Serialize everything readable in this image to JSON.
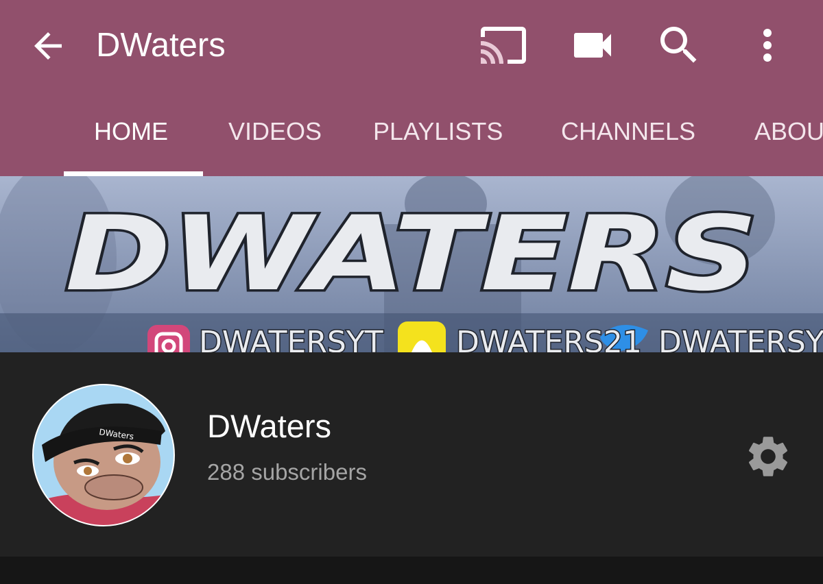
{
  "header": {
    "title": "DWaters",
    "back_icon": "arrow-back-icon",
    "actions": [
      "cast-icon",
      "video-camera-icon",
      "search-icon",
      "more-vert-icon"
    ],
    "background_color": "#91506C"
  },
  "tabs": [
    {
      "label": "HOME",
      "selected": true
    },
    {
      "label": "VIDEOS",
      "selected": false
    },
    {
      "label": "PLAYLISTS",
      "selected": false
    },
    {
      "label": "CHANNELS",
      "selected": false
    },
    {
      "label": "ABOUT",
      "selected": false
    }
  ],
  "banner": {
    "logo_text": "DWATERS",
    "handle_icons": [
      "instagram-icon",
      "snapchat-icon",
      "twitter-icon"
    ]
  },
  "channel": {
    "name": "DWaters",
    "subscribers": "288 subscribers",
    "settings_icon": "gear-icon",
    "avatar_cap_text": "DWaters"
  }
}
